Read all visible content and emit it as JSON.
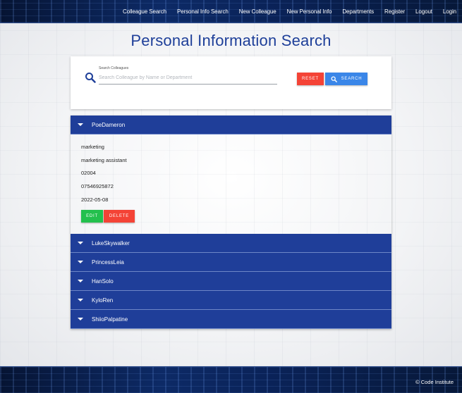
{
  "nav": {
    "items": [
      "Colleague Search",
      "Personal Info Search",
      "New Colleague",
      "New Personal Info",
      "Departments",
      "Register",
      "Logout",
      "Login"
    ]
  },
  "page": {
    "title": "Personal Information Search"
  },
  "search": {
    "label": "Search Colleagues",
    "placeholder": "Search Colleague by Name or Department",
    "value": "",
    "reset_label": "RESET",
    "search_label": "SEARCH",
    "icon": "search-icon"
  },
  "colors": {
    "brand": "#1e3f99",
    "header": "#1f3e99",
    "reset": "#f44336",
    "search": "#3a86e8",
    "edit": "#23c04d",
    "delete": "#f44336"
  },
  "colleagues": [
    {
      "name": "PoeDameron",
      "expanded": true,
      "department": "marketing",
      "role": "marketing assistant",
      "extension": "02004",
      "phone": "07546925872",
      "date": "2022-05-08",
      "edit_label": "EDIT",
      "delete_label": "DELETE"
    },
    {
      "name": "LukeSkywalker"
    },
    {
      "name": "PrincessLeia"
    },
    {
      "name": "HanSolo"
    },
    {
      "name": "KyloRen"
    },
    {
      "name": "ShiioPalpatine"
    }
  ],
  "footer": {
    "copyright": "© Code Institute"
  }
}
